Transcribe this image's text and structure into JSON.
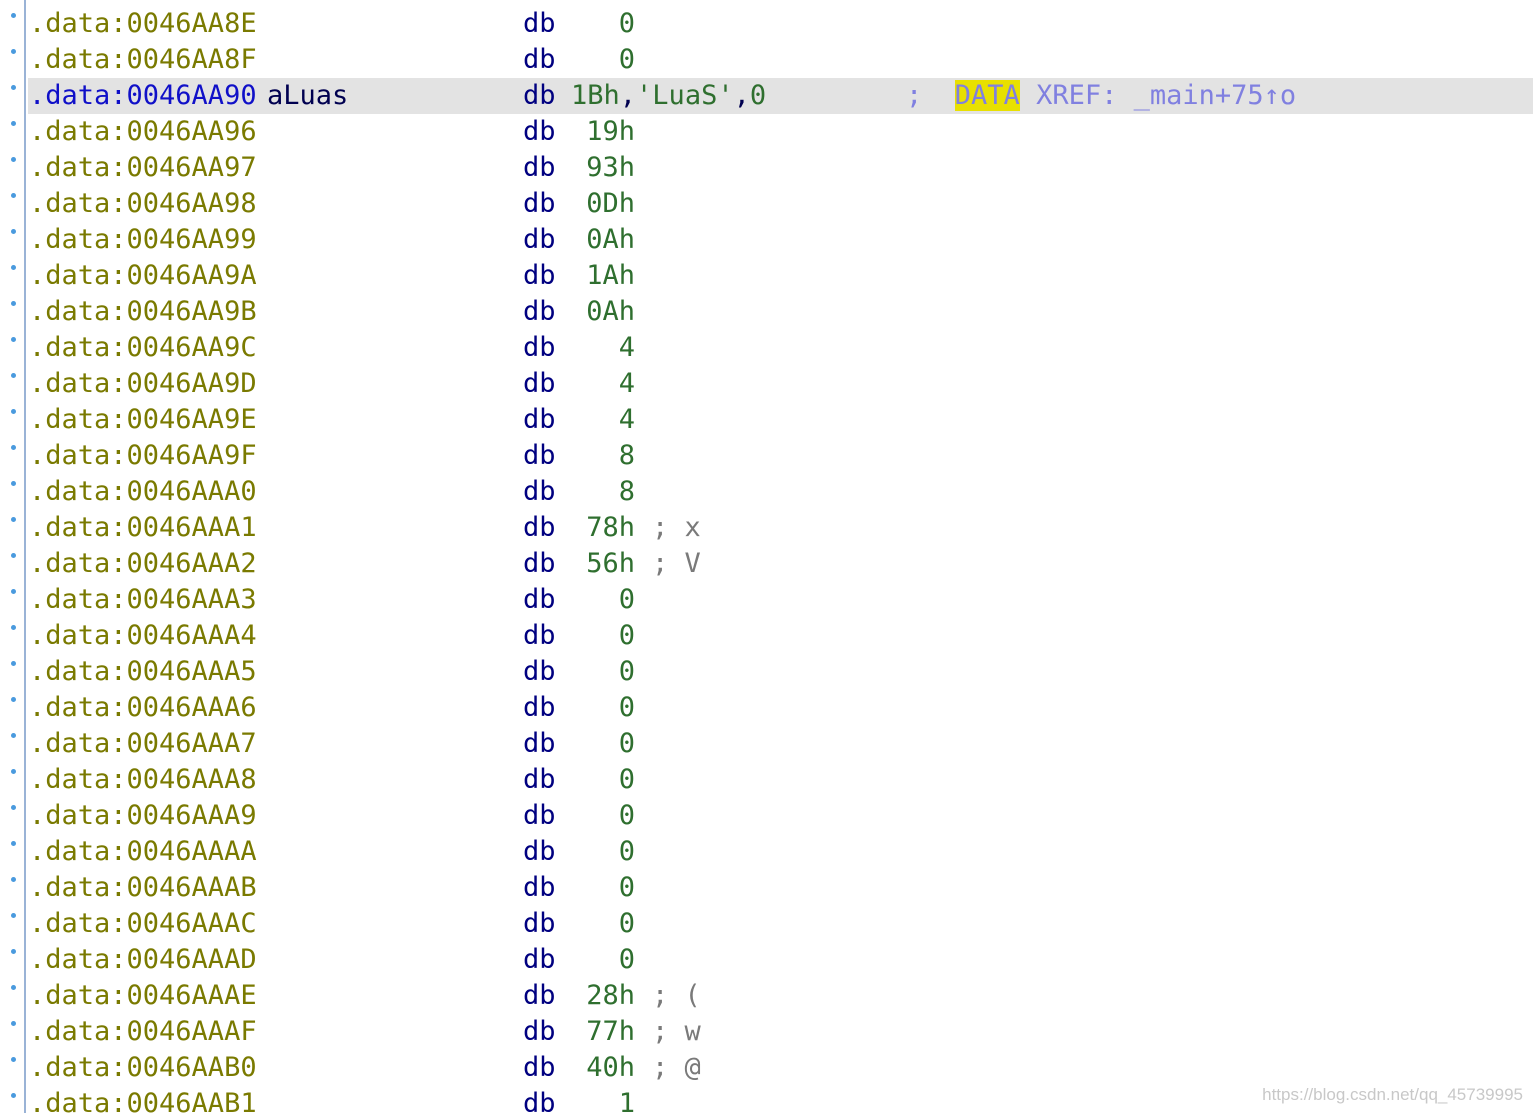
{
  "listing": {
    "rows": [
      {
        "addr": ".data:0046AA8E",
        "label": "",
        "mnem": "db",
        "value": "0",
        "comment": ""
      },
      {
        "addr": ".data:0046AA8F",
        "label": "",
        "mnem": "db",
        "value": "0",
        "comment": ""
      },
      {
        "addr": ".data:0046AA90",
        "label": "aLuas",
        "mnem": "db",
        "selected": true,
        "operand": {
          "num": "1Bh",
          "sep1": ",",
          "str": "'LuaS'",
          "sep2": ",",
          "tail": "0"
        },
        "xref": {
          "semicolon": ";",
          "highlight": "DATA",
          "rest": " XREF: _main+75↑o"
        }
      },
      {
        "addr": ".data:0046AA96",
        "label": "",
        "mnem": "db",
        "value": "19h",
        "comment": ""
      },
      {
        "addr": ".data:0046AA97",
        "label": "",
        "mnem": "db",
        "value": "93h",
        "comment": ""
      },
      {
        "addr": ".data:0046AA98",
        "label": "",
        "mnem": "db",
        "value": "0Dh",
        "comment": ""
      },
      {
        "addr": ".data:0046AA99",
        "label": "",
        "mnem": "db",
        "value": "0Ah",
        "comment": ""
      },
      {
        "addr": ".data:0046AA9A",
        "label": "",
        "mnem": "db",
        "value": "1Ah",
        "comment": ""
      },
      {
        "addr": ".data:0046AA9B",
        "label": "",
        "mnem": "db",
        "value": "0Ah",
        "comment": ""
      },
      {
        "addr": ".data:0046AA9C",
        "label": "",
        "mnem": "db",
        "value": "4",
        "comment": ""
      },
      {
        "addr": ".data:0046AA9D",
        "label": "",
        "mnem": "db",
        "value": "4",
        "comment": ""
      },
      {
        "addr": ".data:0046AA9E",
        "label": "",
        "mnem": "db",
        "value": "4",
        "comment": ""
      },
      {
        "addr": ".data:0046AA9F",
        "label": "",
        "mnem": "db",
        "value": "8",
        "comment": ""
      },
      {
        "addr": ".data:0046AAA0",
        "label": "",
        "mnem": "db",
        "value": "8",
        "comment": ""
      },
      {
        "addr": ".data:0046AAA1",
        "label": "",
        "mnem": "db",
        "value": "78h",
        "comment": "; x"
      },
      {
        "addr": ".data:0046AAA2",
        "label": "",
        "mnem": "db",
        "value": "56h",
        "comment": "; V"
      },
      {
        "addr": ".data:0046AAA3",
        "label": "",
        "mnem": "db",
        "value": "0",
        "comment": ""
      },
      {
        "addr": ".data:0046AAA4",
        "label": "",
        "mnem": "db",
        "value": "0",
        "comment": ""
      },
      {
        "addr": ".data:0046AAA5",
        "label": "",
        "mnem": "db",
        "value": "0",
        "comment": ""
      },
      {
        "addr": ".data:0046AAA6",
        "label": "",
        "mnem": "db",
        "value": "0",
        "comment": ""
      },
      {
        "addr": ".data:0046AAA7",
        "label": "",
        "mnem": "db",
        "value": "0",
        "comment": ""
      },
      {
        "addr": ".data:0046AAA8",
        "label": "",
        "mnem": "db",
        "value": "0",
        "comment": ""
      },
      {
        "addr": ".data:0046AAA9",
        "label": "",
        "mnem": "db",
        "value": "0",
        "comment": ""
      },
      {
        "addr": ".data:0046AAAA",
        "label": "",
        "mnem": "db",
        "value": "0",
        "comment": ""
      },
      {
        "addr": ".data:0046AAAB",
        "label": "",
        "mnem": "db",
        "value": "0",
        "comment": ""
      },
      {
        "addr": ".data:0046AAAC",
        "label": "",
        "mnem": "db",
        "value": "0",
        "comment": ""
      },
      {
        "addr": ".data:0046AAAD",
        "label": "",
        "mnem": "db",
        "value": "0",
        "comment": ""
      },
      {
        "addr": ".data:0046AAAE",
        "label": "",
        "mnem": "db",
        "value": "28h",
        "comment": "; ("
      },
      {
        "addr": ".data:0046AAAF",
        "label": "",
        "mnem": "db",
        "value": "77h",
        "comment": "; w"
      },
      {
        "addr": ".data:0046AAB0",
        "label": "",
        "mnem": "db",
        "value": "40h",
        "comment": "; @"
      },
      {
        "addr": ".data:0046AAB1",
        "label": "",
        "mnem": "db",
        "value": "1",
        "comment": ""
      }
    ]
  },
  "watermark": "https://blog.csdn.net/qq_45739995",
  "colors": {
    "address": "#7a7a00",
    "address_selected": "#1010c8",
    "mnemonic": "#000080",
    "number": "#2f6f2f",
    "comment": "#7a7a7a",
    "xref": "#8080e0",
    "highlight": "#e8e000",
    "selection": "#e3e3e3"
  }
}
